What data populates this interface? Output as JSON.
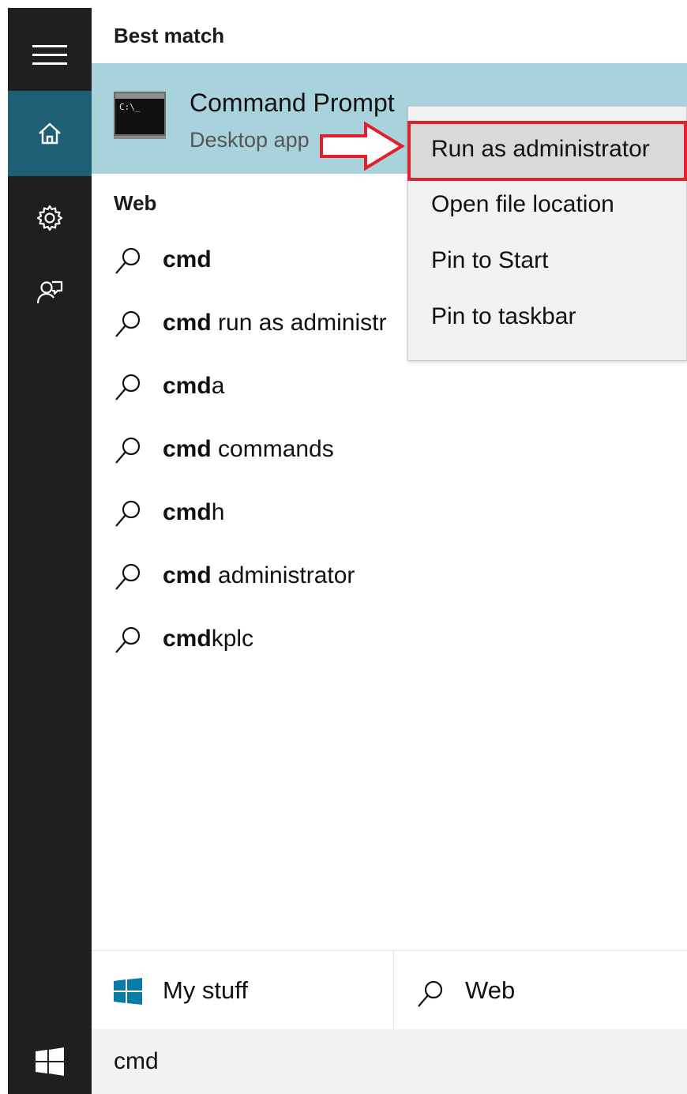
{
  "sidebar": {
    "items": [
      {
        "name": "menu",
        "icon": "hamburger-icon"
      },
      {
        "name": "home",
        "icon": "home-icon",
        "active": true
      },
      {
        "name": "settings",
        "icon": "gear-icon"
      },
      {
        "name": "feedback",
        "icon": "feedback-icon"
      }
    ],
    "start_icon": "windows-start-icon",
    "active_color": "#1f5f73",
    "background": "#1f1f1f"
  },
  "best_match": {
    "section_label": "Best match",
    "title": "Command Prompt",
    "subtitle": "Desktop app",
    "icon_text": "C:\\_",
    "highlight_color": "#a9d3dc"
  },
  "web": {
    "section_label": "Web",
    "results": [
      {
        "bold": "cmd",
        "rest": ""
      },
      {
        "bold": "cmd",
        "rest": " run as administr"
      },
      {
        "bold": "cmd",
        "rest": "a"
      },
      {
        "bold": "cmd",
        "rest": " commands"
      },
      {
        "bold": "cmd",
        "rest": "h"
      },
      {
        "bold": "cmd",
        "rest": " administrator"
      },
      {
        "bold": "cmd",
        "rest": "kplc"
      }
    ]
  },
  "tabs": {
    "my_stuff": "My stuff",
    "web": "Web"
  },
  "search": {
    "query": "cmd"
  },
  "context_menu": {
    "items": [
      {
        "label": "Run as administrator",
        "highlighted": true
      },
      {
        "label": "Open file location"
      },
      {
        "label": "Pin to Start"
      },
      {
        "label": "Pin to taskbar"
      }
    ],
    "annotation_color": "#e0202b"
  }
}
